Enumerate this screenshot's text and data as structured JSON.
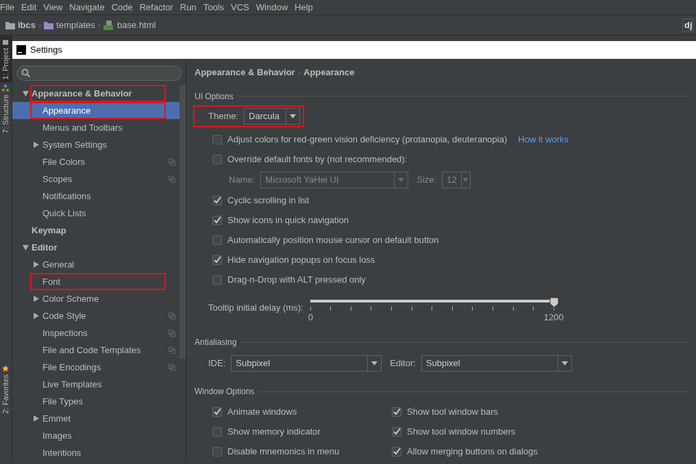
{
  "menu": [
    "File",
    "Edit",
    "View",
    "Navigate",
    "Code",
    "Refactor",
    "Run",
    "Tools",
    "VCS",
    "Window",
    "Help"
  ],
  "breadcrumbs": [
    {
      "label": "lbcs",
      "kind": "folder",
      "bold": true,
      "separator": "›"
    },
    {
      "label": "templates",
      "kind": "template-folder",
      "bold": false,
      "separator": "›"
    },
    {
      "label": "base.html",
      "kind": "html",
      "bold": false
    }
  ],
  "run_config": "dj",
  "tool_strip": [
    {
      "label": "1: Project",
      "kind": "project",
      "selected": true
    },
    {
      "label": "7: Structure",
      "kind": "structure",
      "selected": false
    },
    {
      "label": "2: Favorites",
      "kind": "favorites",
      "selected": false
    }
  ],
  "window": {
    "title": "Settings"
  },
  "tree": [
    {
      "label": "Appearance & Behavior",
      "expanded": true,
      "selected": false,
      "highlighted": true,
      "children": [
        {
          "label": "Appearance",
          "selected": true,
          "highlighted": true
        },
        {
          "label": "Menus and Toolbars",
          "selected": false
        },
        {
          "label": "System Settings",
          "expanded": false,
          "selected": false
        },
        {
          "label": "File Colors",
          "selected": false,
          "project_level": true
        },
        {
          "label": "Scopes",
          "selected": false,
          "project_level": true
        },
        {
          "label": "Notifications",
          "selected": false
        },
        {
          "label": "Quick Lists",
          "selected": false
        }
      ]
    },
    {
      "label": "Keymap",
      "selected": false
    },
    {
      "label": "Editor",
      "expanded": true,
      "selected": false,
      "children": [
        {
          "label": "General",
          "expanded": false,
          "selected": false
        },
        {
          "label": "Font",
          "selected": false,
          "highlighted": true
        },
        {
          "label": "Color Scheme",
          "expanded": false,
          "selected": false
        },
        {
          "label": "Code Style",
          "expanded": false,
          "selected": false,
          "project_level": true
        },
        {
          "label": "Inspections",
          "selected": false,
          "project_level": true
        },
        {
          "label": "File and Code Templates",
          "selected": false,
          "project_level": true
        },
        {
          "label": "File Encodings",
          "selected": false,
          "project_level": true
        },
        {
          "label": "Live Templates",
          "selected": false
        },
        {
          "label": "File Types",
          "selected": false
        },
        {
          "label": "Emmet",
          "expanded": false,
          "selected": false
        },
        {
          "label": "Images",
          "selected": false
        },
        {
          "label": "Intentions",
          "selected": false
        }
      ]
    }
  ],
  "path": [
    {
      "label": "Appearance & Behavior",
      "separator": "›"
    },
    {
      "label": "Appearance"
    }
  ],
  "ui_options": {
    "title": "UI Options",
    "rows": [
      {
        "kind": "theme",
        "label": "Theme:",
        "value": "Darcula",
        "highlighted": true
      },
      {
        "kind": "checkbox",
        "label": "Adjust colors for red-green vision deficiency (protanopia, deuteranopia)",
        "checked": false,
        "link": "How it works"
      },
      {
        "kind": "checkbox",
        "label": "Override default fonts by (not recommended):",
        "checked": false
      },
      {
        "kind": "fonts",
        "name_label": "Name:",
        "name": "Microsoft YaHei UI",
        "size_label": "Size:",
        "size": "12",
        "disabled": true
      },
      {
        "kind": "checkbox",
        "label": "Cyclic scrolling in list",
        "checked": true
      },
      {
        "kind": "checkbox",
        "label": "Show icons in quick navigation",
        "checked": true
      },
      {
        "kind": "checkbox",
        "label": "Automatically position mouse cursor on default button",
        "checked": false
      },
      {
        "kind": "checkbox",
        "label": "Hide navigation popups on focus loss",
        "checked": true
      },
      {
        "kind": "checkbox",
        "label": "Drag-n-Drop with ALT pressed only",
        "checked": false
      },
      {
        "kind": "slider",
        "label": "Tooltip initial delay (ms):",
        "level": 1,
        "min": "0",
        "max": "1200"
      }
    ]
  },
  "antialiasing": {
    "title": "Antialiasing",
    "ide": {
      "label": "IDE:",
      "value": "Subpixel"
    },
    "editor": {
      "label": "Editor:",
      "value": "Subpixel"
    }
  },
  "window_options": {
    "title": "Window Options",
    "options": [
      {
        "label": "Animate windows",
        "checked": true
      },
      {
        "label": "Show tool window bars",
        "checked": true
      },
      {
        "label": "Show memory indicator",
        "checked": false
      },
      {
        "label": "Show tool window numbers",
        "checked": true
      },
      {
        "label": "Disable mnemonics in menu",
        "checked": false
      },
      {
        "label": "Allow merging buttons on dialogs",
        "checked": true
      }
    ]
  }
}
